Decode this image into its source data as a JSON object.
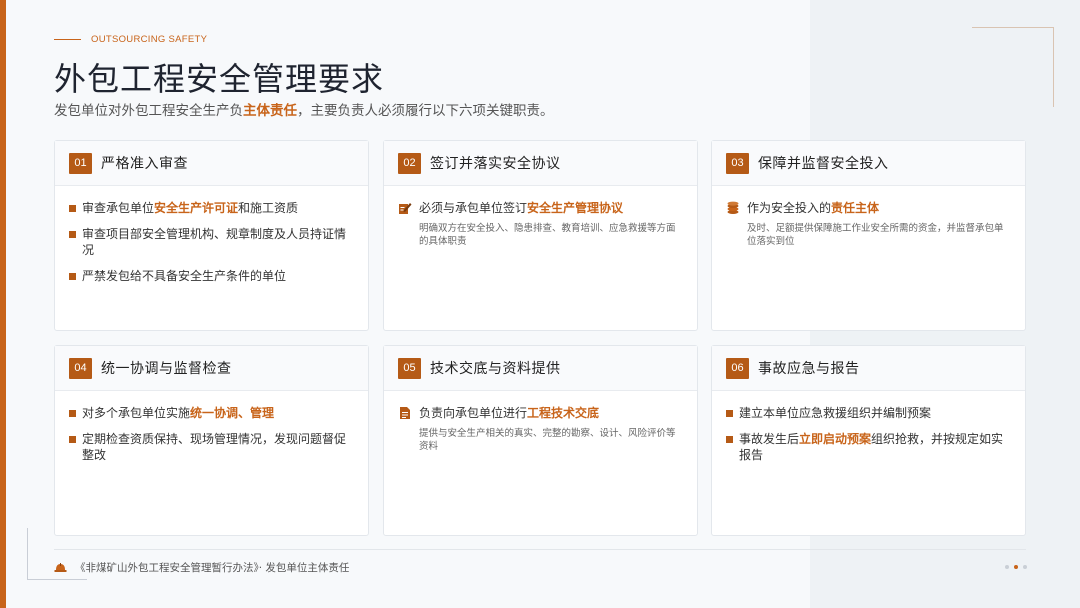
{
  "header": {
    "eyebrow": "OUTSOURCING SAFETY",
    "title": "外包工程安全管理要求",
    "subtitle": {
      "before": "发包单位对外包工程安全生产负",
      "highlight": "主体责任",
      "after": "，主要负责人必须履行以下六项关键职责。"
    }
  },
  "cards": [
    {
      "number": "01",
      "title": "严格准入审查",
      "items": [
        {
          "before": "审查承包单位",
          "highlight": "安全生产许可证",
          "after": "和施工资质"
        },
        {
          "before": "审查项目部安全管理机构、规章制度及人员持证情况",
          "highlight": "",
          "after": ""
        },
        {
          "before": "严禁发包给不具备安全生产条件的单位",
          "highlight": "",
          "after": ""
        }
      ]
    },
    {
      "number": "02",
      "title": "签订并落实安全协议",
      "icon": "contract-sign-icon",
      "main": {
        "before": "必须与承包单位签订",
        "highlight": "安全生产管理协议",
        "after": ""
      },
      "desc": "明确双方在安全投入、隐患排查、教育培训、应急救援等方面的具体职责"
    },
    {
      "number": "03",
      "title": "保障并监督安全投入",
      "icon": "coins-icon",
      "main": {
        "before": "作为安全投入的",
        "highlight": "责任主体",
        "after": ""
      },
      "desc": "及时、足额提供保障施工作业安全所需的资金，并监督承包单位落实到位"
    },
    {
      "number": "04",
      "title": "统一协调与监督检查",
      "items": [
        {
          "before": "对多个承包单位实施",
          "highlight": "统一协调、管理",
          "after": ""
        },
        {
          "before": "定期检查资质保持、现场管理情况，发现问题督促整改",
          "highlight": "",
          "after": ""
        }
      ]
    },
    {
      "number": "05",
      "title": "技术交底与资料提供",
      "icon": "document-icon",
      "main": {
        "before": "负责向承包单位进行",
        "highlight": "工程技术交底",
        "after": ""
      },
      "desc": "提供与安全生产相关的真实、完整的勘察、设计、风险评价等资料"
    },
    {
      "number": "06",
      "title": "事故应急与报告",
      "items": [
        {
          "before": "建立本单位应急救援组织并编制预案",
          "highlight": "",
          "after": ""
        },
        {
          "before": "事故发生后",
          "highlight": "立即启动预案",
          "after": "组织抢救，并按规定如实报告"
        }
      ]
    }
  ],
  "footer": {
    "icon": "hard-hat-icon",
    "text": "《非煤矿山外包工程安全管理暂行办法》· 发包单位主体责任"
  },
  "pagination": {
    "total": 3,
    "active": 2
  },
  "colors": {
    "accent": "#c8641a",
    "badge": "#b55a16"
  }
}
